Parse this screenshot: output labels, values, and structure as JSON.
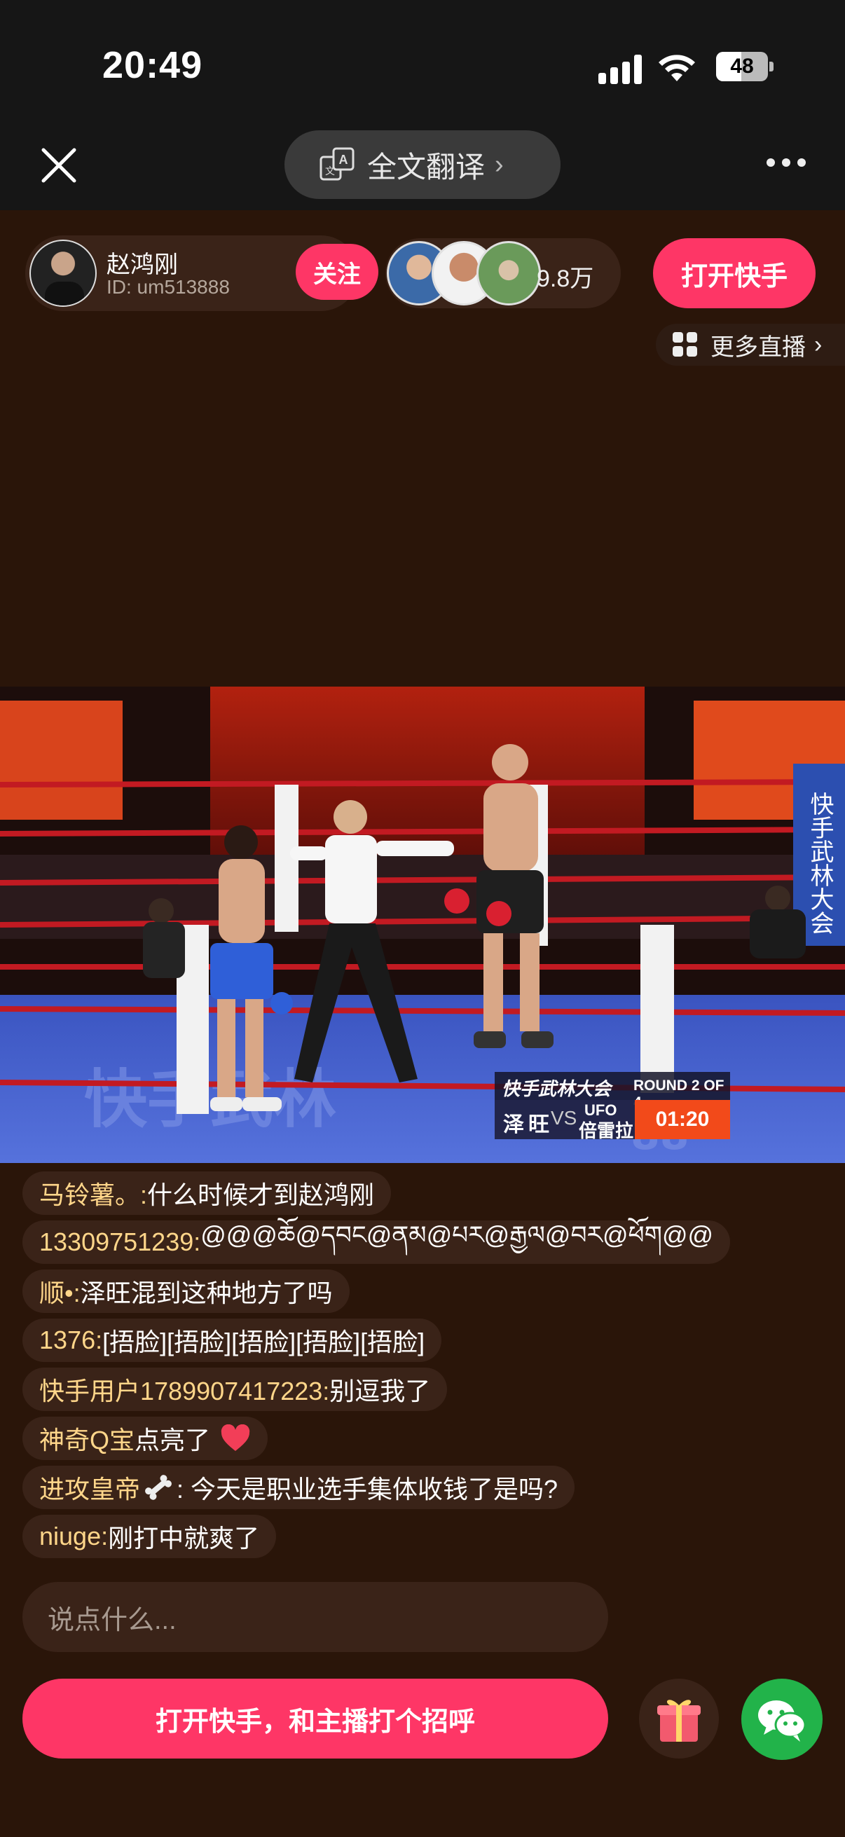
{
  "status_bar": {
    "time": "20:49",
    "battery": "48",
    "battery_level": 0.48
  },
  "top_bar": {
    "translate_label": "全文翻译",
    "translate_chevron": "›"
  },
  "host": {
    "name": "赵鸿刚",
    "id": "ID: um513888",
    "follow_label": "关注"
  },
  "viewers": {
    "count": "9.8万"
  },
  "open_app_label": "打开快手",
  "more_live_label": "更多直播",
  "more_live_chevron": "›",
  "scoreboard": {
    "event": "快手武林大会",
    "round": "ROUND 2 OF 4",
    "fighter1": "泽旺",
    "vs": "VS",
    "fighter2_line1": "UFO",
    "fighter2_line2": "倍雷拉",
    "timer": "01:20"
  },
  "comments": [
    {
      "user": "马铃薯。: ",
      "msg": "什么时候才到赵鸿刚"
    },
    {
      "user": "13309751239: ",
      "msg": "@@@ཆོ@དབང@ནམ@པར@རྒྱལ@བར@ཕོག@@"
    },
    {
      "user": "顺•: ",
      "msg": "泽旺混到这种地方了吗"
    },
    {
      "user": "1376: ",
      "msg": "[捂脸][捂脸][捂脸][捂脸][捂脸]"
    },
    {
      "user": "快手用户1789907417223: ",
      "msg": "别逗我了"
    },
    {
      "user": "神奇Q宝 ",
      "msg": "点亮了"
    },
    {
      "user": "进攻皇帝",
      "msg": ": 今天是职业选手集体收钱了是吗?"
    },
    {
      "user": "niuge: ",
      "msg": "刚打中就爽了"
    }
  ],
  "input": {
    "placeholder": "说点什么..."
  },
  "greet_label": "打开快手，和主播打个招呼",
  "colors": {
    "accent": "#fe3666",
    "background": "#2a1509",
    "username": "#ffd68a",
    "wechat": "#22b34a"
  }
}
